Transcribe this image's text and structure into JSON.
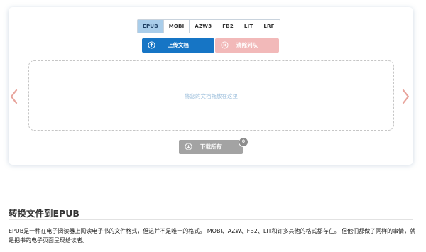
{
  "formats": [
    "EPUB",
    "MOBI",
    "AZW3",
    "FB2",
    "LIT",
    "LRF"
  ],
  "active_format": "EPUB",
  "upload_button": {
    "label": "上传文档",
    "icon": "upload-circle-icon"
  },
  "clear_button": {
    "label": "清除列队",
    "icon": "close-circle-icon"
  },
  "dropzone": {
    "text": "将您的文档拖放在这里"
  },
  "nav": {
    "left_icon": "chevron-left-icon",
    "right_icon": "chevron-right-icon"
  },
  "download_button": {
    "label": "下载所有",
    "icon": "download-circle-icon",
    "count": "0"
  },
  "section": {
    "title": "转换文件到EPUB",
    "description": "EPUB是一种在电子阅读器上阅读电子书的文件格式，但这并不是唯一的格式。 MOBI、AZW、FB2、LIT和许多其他的格式都存在。 但他们都做了同样的事情，就是把书的电子页面呈现给读者。"
  },
  "colors": {
    "accent": "#1675c5",
    "active_tab": "#a9cdea",
    "clear": "#f2b9b9",
    "arrow": "#e8a49c",
    "download": "#a3a3a3"
  }
}
